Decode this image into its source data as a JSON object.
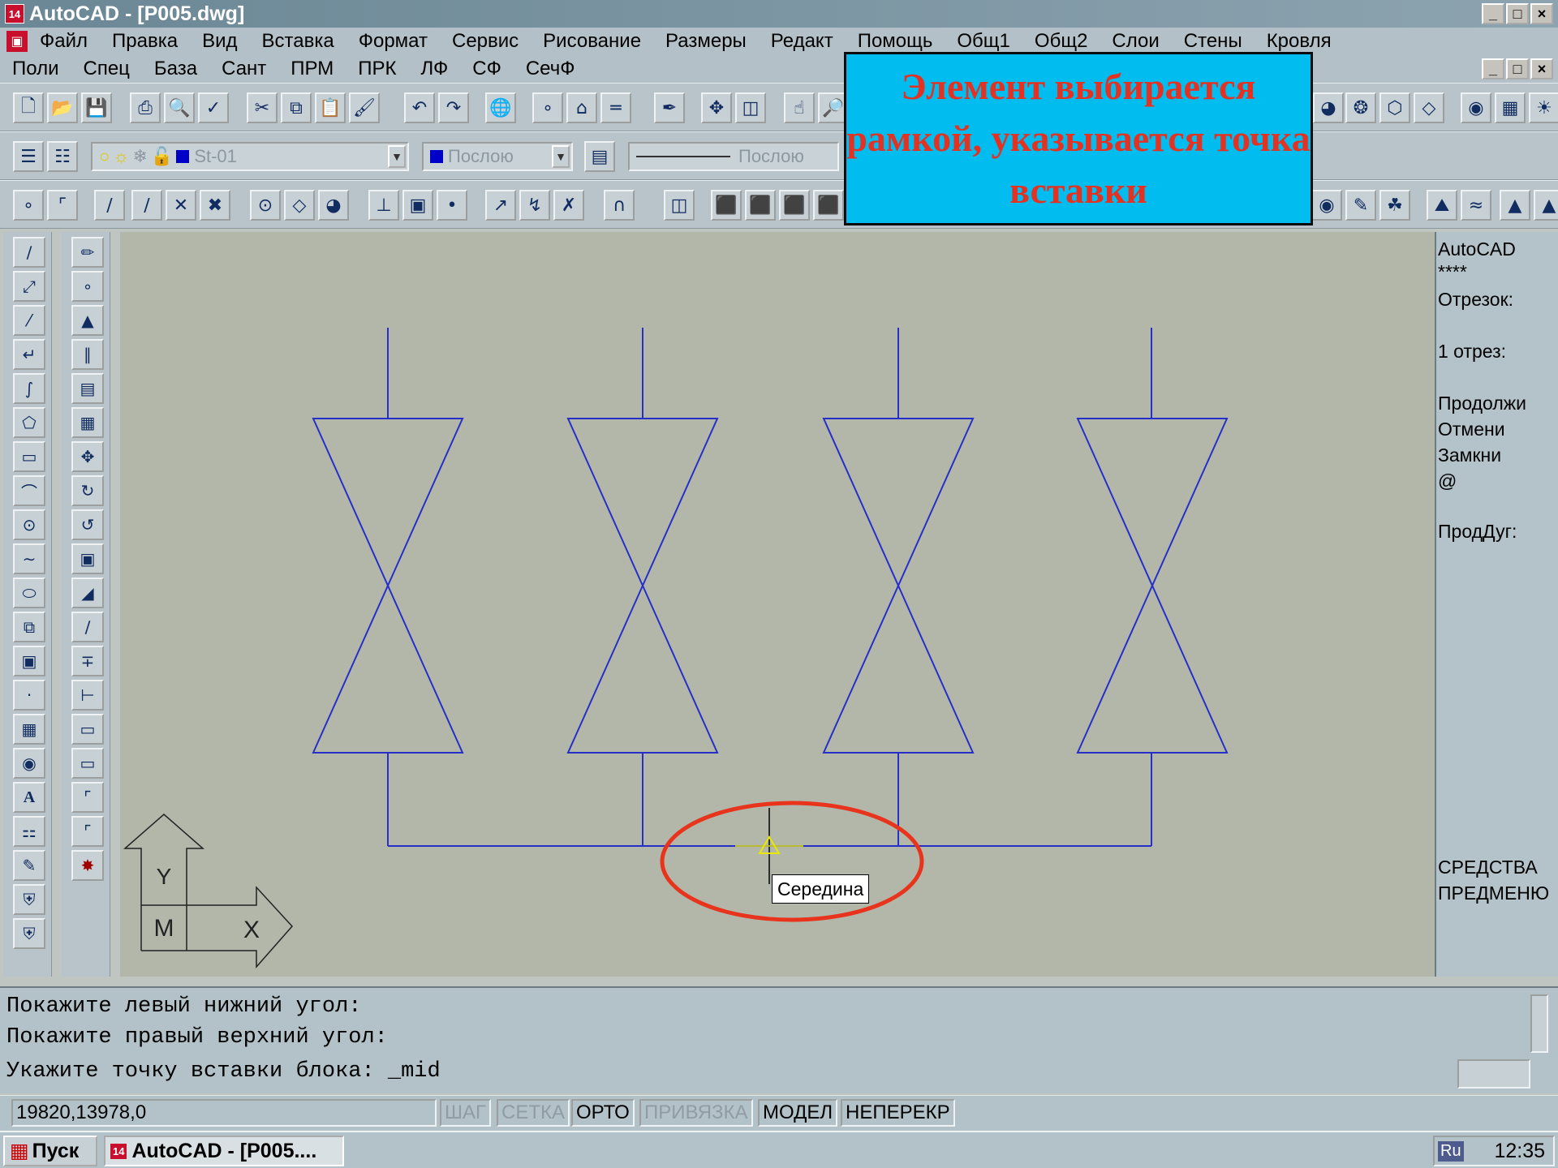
{
  "window": {
    "title": "AutoCAD - [P005.dwg]",
    "app_icon": "14",
    "controls": [
      "_",
      "□",
      "×"
    ]
  },
  "menubar_main": [
    "Файл",
    "Правка",
    "Вид",
    "Вставка",
    "Формат",
    "Сервис",
    "Рисование",
    "Размеры",
    "Редакт",
    "Помощь",
    "Общ1",
    "Общ2",
    "Слои",
    "Стены",
    "Кровля"
  ],
  "menubar_extra": [
    "Поли",
    "Спец",
    "База",
    "Сант",
    "ПРМ",
    "ПРК",
    "ЛФ",
    "СФ",
    "СечФ"
  ],
  "layers": {
    "current_layer": "St-01",
    "color": "Послою",
    "linetype": "Послою"
  },
  "callout": {
    "text": "Элемент выбирается рамкой, указывается точка вставки"
  },
  "tooltip": "Середина",
  "ucs": {
    "y_label": "Y",
    "m_label": "M",
    "x_label": "X"
  },
  "screen_menu": [
    "AutoCAD",
    "****",
    "Отрезок:",
    "1 отрез:",
    "Продолжи",
    "Отмени",
    "Замкни",
    "@",
    "ПродДуг:",
    "СРЕДСТВА",
    "ПРЕДМЕНЮ"
  ],
  "command": {
    "history": [
      "Покажите левый нижний угол:",
      "Покажите правый верхний угол:"
    ],
    "prompt": "Укажите точку вставки блока: _mid"
  },
  "status": {
    "coords": "19820,13978,0",
    "toggles": [
      {
        "label": "ШАГ",
        "on": false
      },
      {
        "label": "СЕТКА",
        "on": false
      },
      {
        "label": "ОРТО",
        "on": true
      },
      {
        "label": "ПРИВЯЗКА",
        "on": false
      },
      {
        "label": "МОДЕЛ",
        "on": true
      },
      {
        "label": "НЕПЕРЕКР",
        "on": true
      }
    ]
  },
  "taskbar": {
    "start": "Пуск",
    "task": "AutoCAD - [P005....",
    "lang": "Ru",
    "time": "12:35"
  },
  "colors": {
    "drawing_line": "#2630c8",
    "canvas": "#b2b7aa",
    "callout_bg": "#00bcef",
    "callout_text": "#e43222",
    "highlight_ellipse": "#e8341c",
    "snap_marker": "#e8e800"
  }
}
